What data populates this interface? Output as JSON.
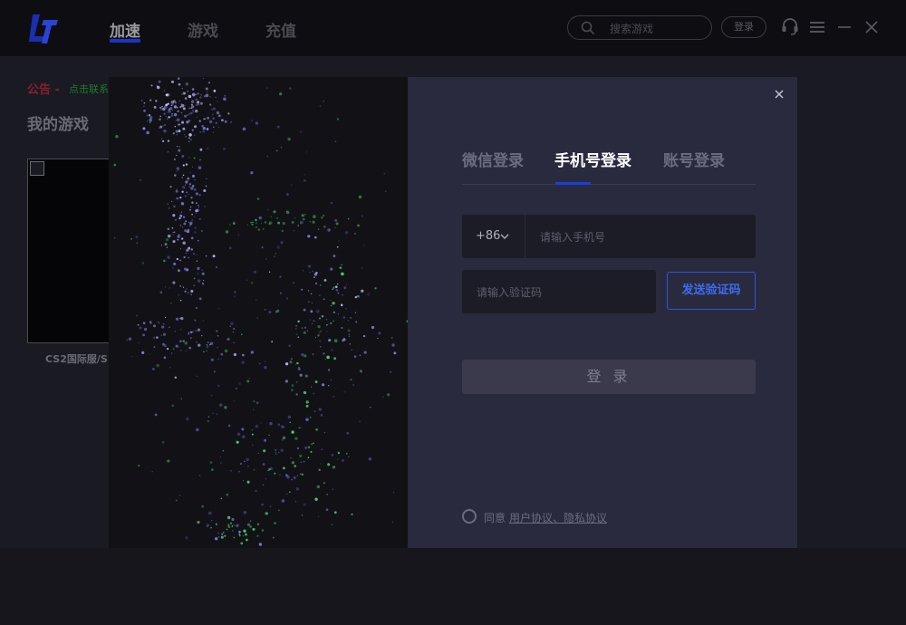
{
  "app": {
    "logo_icon": "lt-logo-icon",
    "nav": [
      {
        "label": "加速",
        "active": true
      },
      {
        "label": "游戏",
        "active": false
      },
      {
        "label": "充值",
        "active": false
      }
    ],
    "search": {
      "placeholder": "搜索游戏"
    },
    "login_label": "登录",
    "icons": [
      "headset-icon",
      "menu-icon",
      "minimize-icon",
      "close-icon"
    ],
    "accent": "#1b34c8"
  },
  "page": {
    "notice_label": "公告 -",
    "notice_link": "点击联系",
    "section_title": "我的游戏",
    "game_card": {
      "name": "CS2国际服/S"
    }
  },
  "modal": {
    "tabs": [
      {
        "label": "微信登录",
        "active": false
      },
      {
        "label": "手机号登录",
        "active": true
      },
      {
        "label": "账号登录",
        "active": false
      }
    ],
    "country_code": "+86",
    "phone_placeholder": "请输入手机号",
    "code_placeholder": "请输入验证码",
    "send_code_label": "发送验证码",
    "submit_label": "登 录",
    "agree_prefix": "同意",
    "agree_links": "用户协议、隐私协议",
    "colors": {
      "panel": "#2a2a3e",
      "accent": "#1b3ee0",
      "send": "#3d6cf0"
    }
  }
}
